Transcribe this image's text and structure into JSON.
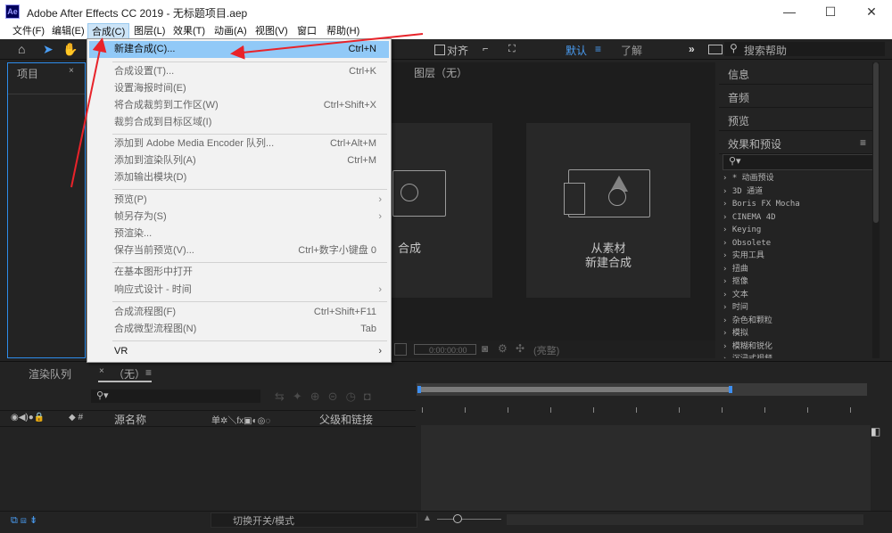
{
  "window": {
    "app_icon": "Ae",
    "title": "Adobe After Effects CC 2019 - 无标题项目.aep",
    "minimize": "—",
    "maximize": "☐",
    "close": "✕"
  },
  "menubar": {
    "items": [
      "文件(F)",
      "编辑(E)",
      "合成(C)",
      "图层(L)",
      "效果(T)",
      "动画(A)",
      "视图(V)",
      "窗口",
      "帮助(H)"
    ],
    "active_index": 2
  },
  "toolbar": {
    "align_label": "对齐",
    "workspace_default": "默认",
    "workspace_learn": "了解",
    "search_placeholder": "搜索帮助",
    "more": "»"
  },
  "panels": {
    "project_tab": "项目",
    "layer_tab": "图层（无）",
    "composition_card_label": "合成",
    "from_footage_line1": "从素材",
    "from_footage_line2": "新建合成",
    "viewer_timecode": "0:00:00:00",
    "viewer_camera": "(亮整)"
  },
  "right_panel": {
    "info": "信息",
    "audio": "音频",
    "preview": "预览",
    "effects_title": "效果和预设",
    "effects_search_icon": "search-icon",
    "effects_items": [
      "› * 动画预设",
      "› 3D 通道",
      "› Boris FX Mocha",
      "› CINEMA 4D",
      "› Keying",
      "› Obsolete",
      "› 实用工具",
      "› 扭曲",
      "› 抠像",
      "› 文本",
      "› 时间",
      "› 杂色和颗粒",
      "› 模拟",
      "› 模糊和锐化",
      "› 沉浸式视频"
    ]
  },
  "timeline": {
    "render_queue_tab": "渲染队列",
    "comp_tab": "（无）",
    "col_source_name": "源名称",
    "col_switches": "单✲＼fx▣◐◎◌",
    "col_parent": "父级和链接",
    "toggle_switches_modes": "切换开关/模式"
  },
  "composition_menu": {
    "items": [
      {
        "label": "新建合成(C)...",
        "shortcut": "Ctrl+N",
        "enabled": true,
        "highlight": true,
        "submenu": false
      },
      {
        "separator": true
      },
      {
        "label": "合成设置(T)...",
        "shortcut": "Ctrl+K",
        "enabled": false,
        "submenu": false
      },
      {
        "label": "设置海报时间(E)",
        "shortcut": "",
        "enabled": false,
        "submenu": false
      },
      {
        "label": "将合成裁剪到工作区(W)",
        "shortcut": "Ctrl+Shift+X",
        "enabled": false,
        "submenu": false
      },
      {
        "label": "裁剪合成到目标区域(I)",
        "shortcut": "",
        "enabled": false,
        "submenu": false
      },
      {
        "separator": true
      },
      {
        "label": "添加到 Adobe Media Encoder 队列...",
        "shortcut": "Ctrl+Alt+M",
        "enabled": false,
        "submenu": false
      },
      {
        "label": "添加到渲染队列(A)",
        "shortcut": "Ctrl+M",
        "enabled": false,
        "submenu": false
      },
      {
        "label": "添加输出模块(D)",
        "shortcut": "",
        "enabled": false,
        "submenu": false
      },
      {
        "separator": true
      },
      {
        "label": "预览(P)",
        "shortcut": "",
        "enabled": false,
        "submenu": true
      },
      {
        "label": "帧另存为(S)",
        "shortcut": "",
        "enabled": false,
        "submenu": true
      },
      {
        "label": "预渲染...",
        "shortcut": "",
        "enabled": false,
        "submenu": false
      },
      {
        "label": "保存当前预览(V)...",
        "shortcut": "Ctrl+数字小键盘 0",
        "enabled": false,
        "submenu": false
      },
      {
        "separator": true
      },
      {
        "label": "在基本图形中打开",
        "shortcut": "",
        "enabled": false,
        "submenu": false
      },
      {
        "label": "响应式设计 - 时间",
        "shortcut": "",
        "enabled": false,
        "submenu": true
      },
      {
        "separator": true
      },
      {
        "label": "合成流程图(F)",
        "shortcut": "Ctrl+Shift+F11",
        "enabled": false,
        "submenu": false
      },
      {
        "label": "合成微型流程图(N)",
        "shortcut": "Tab",
        "enabled": false,
        "submenu": false
      },
      {
        "separator": true
      },
      {
        "label": "VR",
        "shortcut": "",
        "enabled": true,
        "submenu": true
      }
    ]
  },
  "annotation_color": "#e8232a"
}
